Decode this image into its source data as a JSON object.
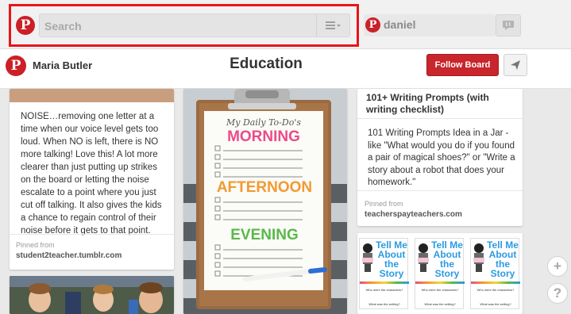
{
  "header": {
    "logo": "P",
    "search": {
      "placeholder": "Search"
    },
    "user": {
      "name": "daniel",
      "icon": "P"
    }
  },
  "board": {
    "owner": "Maria Butler",
    "title": "Education",
    "follow_label": "Follow Board"
  },
  "pins": {
    "left": {
      "description": "NOISE…removing one letter at a time when our voice level gets too loud. When NO is left, there is NO more talking! Love this! A lot more clearer than just putting up strikes on the board or letting the noise escalate to a point where you just cut off talking. It also gives the kids a chance to regain control of their noise before it gets to that point.",
      "pinned_from": "Pinned from",
      "source": "student2teacher.tumblr.com"
    },
    "center": {
      "handwriting": "My Daily To-Do's",
      "sections": [
        "MORNING",
        "AFTERNOON",
        "EVENING"
      ]
    },
    "right": {
      "title": "101+ Writing Prompts (with writing checklist)",
      "description": "101 Writing Prompts Idea in a Jar - like \"What would you do if you found a pair of magical shoes?\" or \"Write a story about a robot that does your homework.\"",
      "pinned_from": "Pinned from",
      "source": "teacherspayteachers.com"
    },
    "story": {
      "title_lines": [
        "Tell Me",
        "About",
        "the",
        "Story"
      ],
      "q1": "Who were the characters?",
      "q2": "What was the setting?"
    }
  },
  "side": {
    "add": "+",
    "help": "?"
  },
  "colors": {
    "pinterest_red": "#cb2027",
    "highlight": "#e8141c",
    "follow": "#c9252c",
    "morning_pink": "#ec4b8a",
    "afternoon_orange": "#f29a32",
    "evening_green": "#59b94a"
  }
}
